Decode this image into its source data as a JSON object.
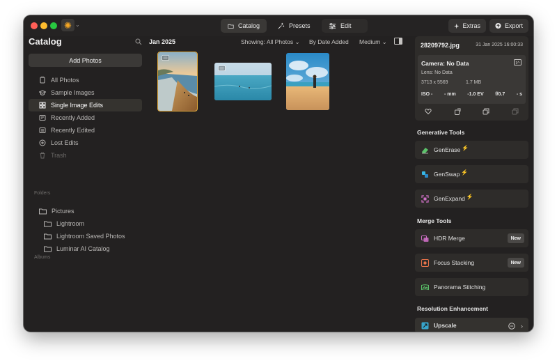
{
  "titlebar": {
    "tabs": [
      {
        "label": "Catalog",
        "icon": "folder-icon"
      },
      {
        "label": "Presets",
        "icon": "sparkle-icon"
      },
      {
        "label": "Edit",
        "icon": "sliders-icon"
      }
    ],
    "extras_label": "Extras",
    "export_label": "Export"
  },
  "sidebar": {
    "title": "Catalog",
    "add_photos_label": "Add Photos",
    "items": [
      {
        "label": "All Photos",
        "icon": "photos-icon"
      },
      {
        "label": "Sample Images",
        "icon": "graduation-icon"
      },
      {
        "label": "Single Image Edits",
        "icon": "grid-icon",
        "active": true
      },
      {
        "label": "Recently Added",
        "icon": "recent-added-icon"
      },
      {
        "label": "Recently Edited",
        "icon": "recent-edited-icon"
      },
      {
        "label": "Lost Edits",
        "icon": "lost-edits-icon"
      },
      {
        "label": "Trash",
        "icon": "trash-icon",
        "dim": true
      }
    ],
    "folders_heading": "Folders",
    "folders": [
      {
        "label": "Pictures",
        "level": 0
      },
      {
        "label": "Lightroom",
        "level": 1
      },
      {
        "label": "Lightroom Saved Photos",
        "level": 1
      },
      {
        "label": "Luminar AI Catalog",
        "level": 1
      }
    ],
    "albums_heading": "Albums"
  },
  "main": {
    "date_label": "Jan 2025",
    "showing_label": "Showing: All Photos",
    "sort_label": "By Date Added",
    "size_label": "Medium",
    "photos": [
      {
        "name": "beach-sunset",
        "selected": true
      },
      {
        "name": "ocean-swimmers",
        "selected": false
      },
      {
        "name": "beach-person",
        "selected": false
      }
    ]
  },
  "info": {
    "filename": "28209792.jpg",
    "date": "31 Jan 2025 16:00:33",
    "camera": "Camera: No Data",
    "lens": "Lens: No Data",
    "dimensions": "3713 x 5569",
    "filesize": "1.7 MB",
    "iso": "ISO -",
    "focal": "- mm",
    "ev": "-1.0 EV",
    "aperture": "f/0.7",
    "shutter": "- s"
  },
  "generative_tools": {
    "heading": "Generative Tools",
    "items": [
      {
        "label": "GenErase",
        "icon": "eraser-icon",
        "color": "#5bc26a"
      },
      {
        "label": "GenSwap",
        "icon": "swap-icon",
        "color": "#38b8e6"
      },
      {
        "label": "GenExpand",
        "icon": "expand-icon",
        "color": "#d070c8"
      }
    ],
    "bolt": "⚡"
  },
  "merge_tools": {
    "heading": "Merge Tools",
    "items": [
      {
        "label": "HDR Merge",
        "icon": "hdr-icon",
        "badge": "New",
        "color": "#d070c8"
      },
      {
        "label": "Focus Stacking",
        "icon": "focus-icon",
        "badge": "New",
        "color": "#e8734a"
      },
      {
        "label": "Panorama Stitching",
        "icon": "panorama-icon",
        "color": "#5bc26a"
      }
    ]
  },
  "resolution": {
    "heading": "Resolution Enhancement",
    "upscale_label": "Upscale"
  },
  "colors": {
    "accent_selection": "#e0a83a",
    "window_bg": "#232121",
    "panel_bg": "#2e2c2a"
  }
}
